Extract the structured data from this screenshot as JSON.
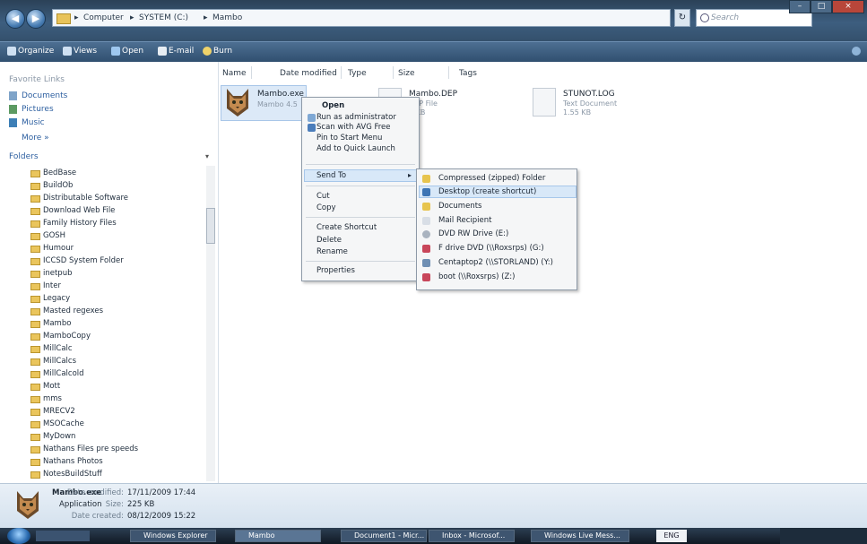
{
  "window": {
    "breadcrumb": [
      "Computer",
      "SYSTEM (C:)",
      "Mambo"
    ],
    "search_placeholder": "Search",
    "controls": [
      "–",
      "□",
      "×"
    ]
  },
  "toolbar": {
    "items": [
      "Organize",
      "Views",
      "Open",
      "E-mail",
      "Burn"
    ]
  },
  "nav": {
    "favorites_title": "Favorite Links",
    "favorites": [
      "Documents",
      "Pictures",
      "Music"
    ],
    "more": "More »",
    "folders_title": "Folders",
    "folders": [
      "BedBase",
      "BuildOb",
      "Distributable Software",
      "Download Web File",
      "Family History Files",
      "GOSH",
      "Humour",
      "ICCSD System Folder",
      "inetpub",
      "Inter",
      "Legacy",
      "Masted regexes",
      "Mambo",
      "MamboCopy",
      "MillCalc",
      "MillCalcs",
      "MillCalcold",
      "Mott",
      "mms",
      "MRECV2",
      "MSOCache",
      "MyDown",
      "Nathans Files pre speeds",
      "Nathans Photos",
      "NotesBuildStuff"
    ]
  },
  "columns": [
    "Name",
    "Date modified",
    "Type",
    "Size",
    "Tags"
  ],
  "files": [
    {
      "name": "Mambo.exe",
      "sub": "Mambo 4.5"
    },
    {
      "name": "Mambo.DEP",
      "sub": "DEP File",
      "size": "1 KB"
    },
    {
      "name": "STUNOT.LOG",
      "sub": "Text Document",
      "size": "1.55 KB"
    }
  ],
  "context_menu": {
    "items": [
      "Open",
      "Run as administrator",
      "Scan with AVG Free",
      "Pin to Start Menu",
      "Add to Quick Launch",
      "Send To",
      "Cut",
      "Copy",
      "Create Shortcut",
      "Delete",
      "Rename",
      "Properties"
    ]
  },
  "sendto_menu": {
    "items": [
      "Compressed (zipped) Folder",
      "Desktop (create shortcut)",
      "Documents",
      "Mail Recipient",
      "DVD RW Drive (E:)",
      "F drive DVD (\\\\Roxsrps) (G:)",
      "Centaptop2 (\\\\STORLAND) (Y:)",
      "boot (\\\\Roxsrps) (Z:)"
    ]
  },
  "details": {
    "name": "Mambo.exe",
    "type": "Application",
    "modified_label": "Date modified:",
    "modified": "17/11/2009 17:44",
    "size_label": "Size:",
    "size": "225 KB",
    "created_label": "Date created:",
    "created": "08/12/2009 15:22"
  },
  "taskbar": {
    "buttons": [
      "Windows Explorer",
      "Mambo",
      "Document1 - Micr...",
      "Inbox - Microsof...",
      "Windows Live Mess..."
    ],
    "lang": "ENG"
  }
}
